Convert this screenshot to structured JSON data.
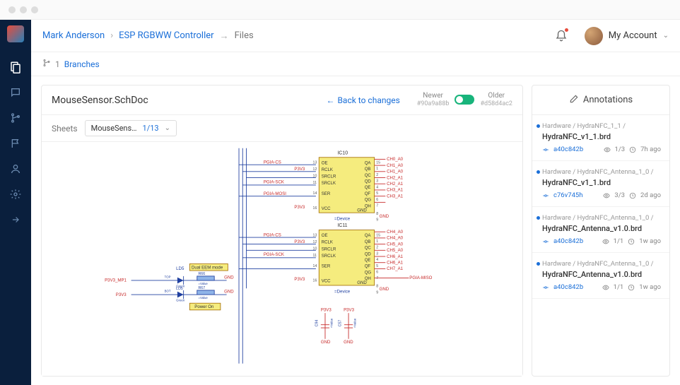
{
  "breadcrumbs": {
    "user": "Mark Anderson",
    "project": "ESP RGBWW Controller",
    "section": "Files"
  },
  "subbar": {
    "count": "1",
    "label": "Branches"
  },
  "account": {
    "label": "My Account"
  },
  "document": {
    "title": "MouseSensor.SchDoc",
    "back_label": "Back to changes"
  },
  "diff": {
    "newer": "Newer",
    "newer_hash": "#90a9a88b",
    "older": "Older",
    "older_hash": "#d58d4ac2"
  },
  "sheets": {
    "label": "Sheets",
    "selected_name": "MouseSens…",
    "page": "1/13"
  },
  "annotations": {
    "title": "Annotations",
    "items": [
      {
        "path": "Hardware / HydraNFC_1_1 /",
        "file": "HydraNFC_v1_1.brd",
        "commit": "a40c842b",
        "count": "1/3",
        "time": "7h ago"
      },
      {
        "path": "Hardware / HydraNFC_Antenna_1_0 /",
        "file": "HydraNFC_v1_1.brd",
        "commit": "c76v745h",
        "count": "3/3",
        "time": "2d ago"
      },
      {
        "path": "Hardware / HydraNFC_Antenna_1_0 /",
        "file": "HydraNFC_Antenna_v1.0.brd",
        "commit": "a40c842b",
        "count": "1/1",
        "time": "1w ago"
      },
      {
        "path": "Hardware / HydraNFC_Antenna_1_0 /",
        "file": "HydraNFC_Antenna_v1.0.brd",
        "commit": "a40c842b",
        "count": "1/1",
        "time": "1w ago"
      }
    ]
  },
  "schematic_labels": {
    "ic10": "IC10",
    "ic11": "IC11",
    "oe": "OE",
    "rclk": "RCLK",
    "srclr": "SRCLR",
    "srclk": "SRCLK",
    "ser": "SER",
    "vcc": "VCC",
    "gnd": "GND",
    "qa": "QA",
    "qb": "QB",
    "qc": "QC",
    "qd": "QD",
    "qe": "QE",
    "qf": "QF",
    "qg": "QG",
    "qh": "QH",
    "device": "=Device",
    "p3v3": "P3V3",
    "p3v3_mp1": "P3V3_MP1",
    "pgia_cs": "PGIA-CS",
    "pgia_sck": "PGIA-SCK",
    "pgia_mosi": "PGIA-MOSI",
    "pgia_miso": "PGIA-MISO",
    "ch0": "CH0_A0",
    "ch1": "CH1_A0",
    "ch2": "CH2_A1",
    "ch3": "CH3_A1",
    "ch4": "CH4_A0",
    "ch5": "CH5_A0",
    "ch6": "CH6_A1",
    "ch7": "CH7_A1",
    "ld5": "LD5",
    "r66": "R66",
    "r67": "R67",
    "top": "TOP",
    "bot": "BOT",
    "green": "Green",
    "value": "=Value",
    "dual_eem": "Dual EEM mode",
    "power_on": "Power On",
    "c94": "C94",
    "c57": "C57",
    "pins": {
      "p13": "13",
      "p12": "12",
      "p10": "10",
      "p11": "11",
      "p14": "14",
      "p16": "16",
      "p15": "15",
      "p1": "1",
      "p2": "2",
      "p3": "3",
      "p4": "4",
      "p5": "5",
      "p6": "6",
      "p7": "7",
      "p8": "8",
      "p9": "9"
    }
  }
}
